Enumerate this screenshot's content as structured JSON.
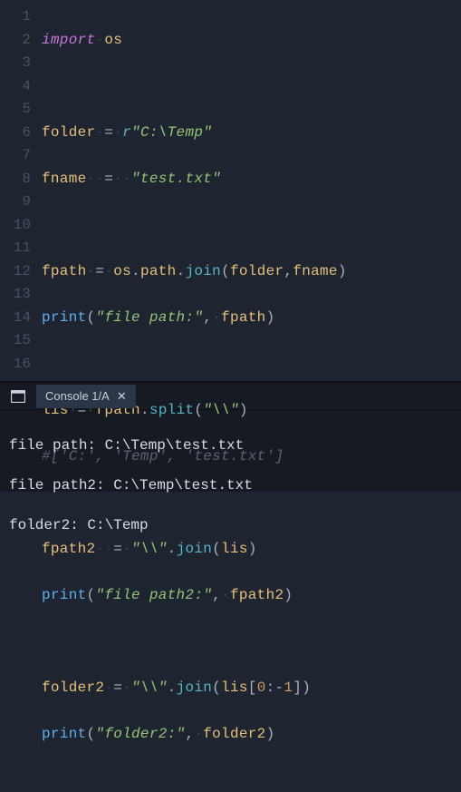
{
  "editor": {
    "lines": [
      1,
      2,
      3,
      4,
      5,
      6,
      7,
      8,
      9,
      10,
      11,
      12,
      13,
      14,
      15,
      16
    ],
    "code": {
      "l1_kw_import": "import",
      "l1_mod": "os",
      "l3_var": "folder",
      "l3_rflag": "r",
      "l3_str": "\"C:\\Temp\"",
      "l4_var": "fname",
      "l4_str": "\"test.txt\"",
      "l6_var": "fpath",
      "l6_mod": "os",
      "l6_path": "path",
      "l6_join": "join",
      "l6_arg1": "folder",
      "l6_arg2": "fname",
      "l7_print": "print",
      "l7_str": "\"file path:\"",
      "l7_arg": "fpath",
      "l9_var": "lis",
      "l9_src": "fpath",
      "l9_split": "split",
      "l9_str": "\"\\\\\"",
      "l10_cmt": "#['C:', 'Temp', 'test.txt']",
      "l12_var": "fpath2",
      "l12_str": "\"\\\\\"",
      "l12_join": "join",
      "l12_arg": "lis",
      "l13_print": "print",
      "l13_str": "\"file path2:\"",
      "l13_arg": "fpath2",
      "l15_var": "folder2",
      "l15_str": "\"\\\\\"",
      "l15_join": "join",
      "l15_arg": "lis",
      "l15_slice0": "0",
      "l15_slice1": "1",
      "l16_print": "print",
      "l16_str": "\"folder2:\"",
      "l16_arg": "folder2"
    }
  },
  "console": {
    "tab_label": "Console 1/A",
    "close_glyph": "✕",
    "output": [
      "file path: C:\\Temp\\test.txt",
      "file path2: C:\\Temp\\test.txt",
      "folder2: C:\\Temp"
    ]
  }
}
